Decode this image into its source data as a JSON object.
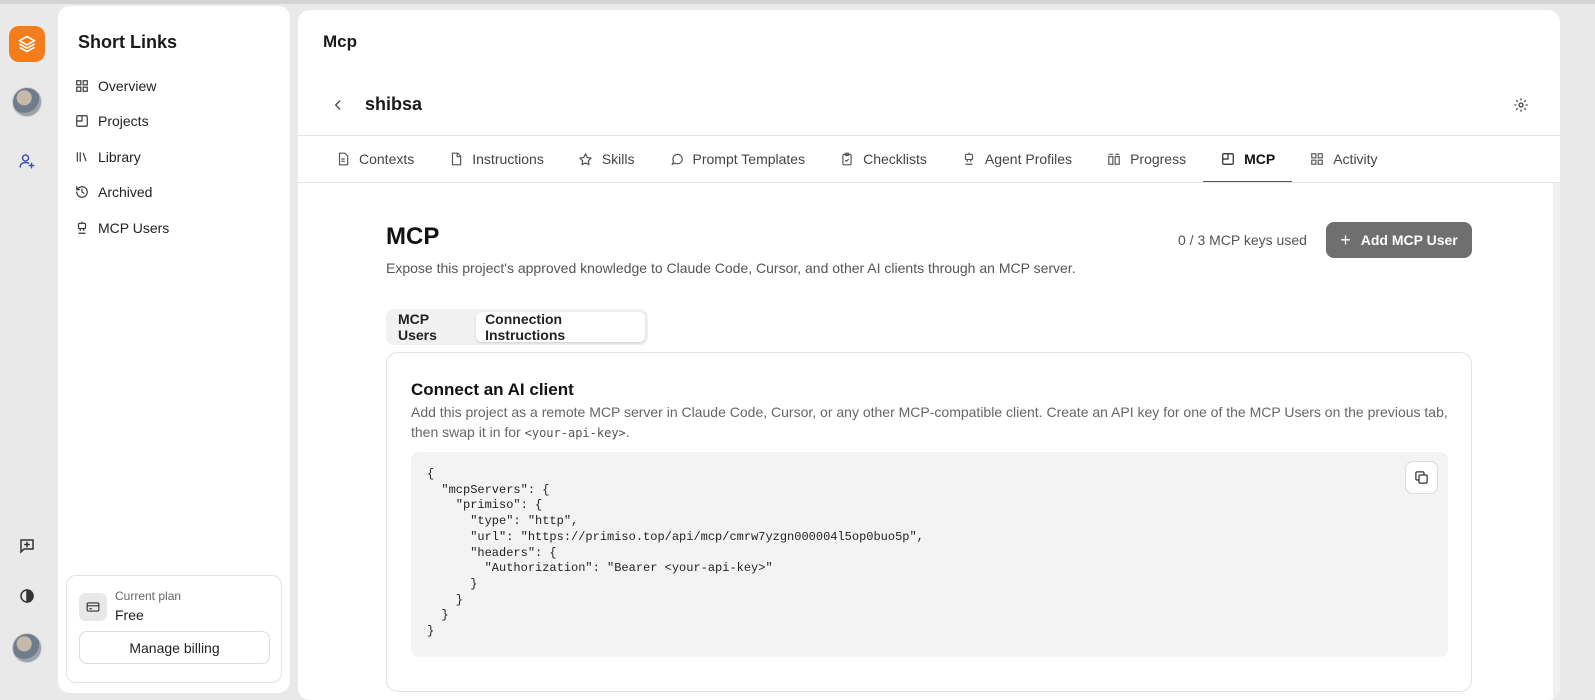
{
  "sidebar": {
    "title": "Short Links",
    "items": [
      {
        "label": "Overview"
      },
      {
        "label": "Projects"
      },
      {
        "label": "Library"
      },
      {
        "label": "Archived"
      },
      {
        "label": "MCP Users"
      }
    ],
    "plan": {
      "label": "Current plan",
      "value": "Free",
      "billing_button": "Manage billing"
    }
  },
  "header": {
    "page_title": "Mcp",
    "project_name": "shibsa"
  },
  "tabs": [
    {
      "label": "Contexts"
    },
    {
      "label": "Instructions"
    },
    {
      "label": "Skills"
    },
    {
      "label": "Prompt Templates"
    },
    {
      "label": "Checklists"
    },
    {
      "label": "Agent Profiles"
    },
    {
      "label": "Progress"
    },
    {
      "label": "MCP",
      "active": true
    },
    {
      "label": "Activity"
    }
  ],
  "mcp": {
    "heading": "MCP",
    "description": "Expose this project's approved knowledge to Claude Code, Cursor, and other AI clients through an MCP server.",
    "keys_used": "0 / 3 MCP keys used",
    "add_button": "Add MCP User",
    "subtabs": [
      {
        "label": "MCP Users"
      },
      {
        "label": "Connection Instructions",
        "active": true
      }
    ],
    "card": {
      "title": "Connect an AI client",
      "description_before": "Add this project as a remote MCP server in Claude Code, Cursor, or any other MCP-compatible client. Create an API key for one of the MCP Users on the previous tab, then swap it in for ",
      "description_code": "<your-api-key>",
      "description_after": ".",
      "code": "{\n  \"mcpServers\": {\n    \"primiso\": {\n      \"type\": \"http\",\n      \"url\": \"https://primiso.top/api/mcp/cmrw7yzgn000004l5op0buo5p\",\n      \"headers\": {\n        \"Authorization\": \"Bearer <your-api-key>\"\n      }\n    }\n  }\n}"
    }
  },
  "colors": {
    "accent": "#f57c1a",
    "primary_button": "#6f6f6f"
  }
}
